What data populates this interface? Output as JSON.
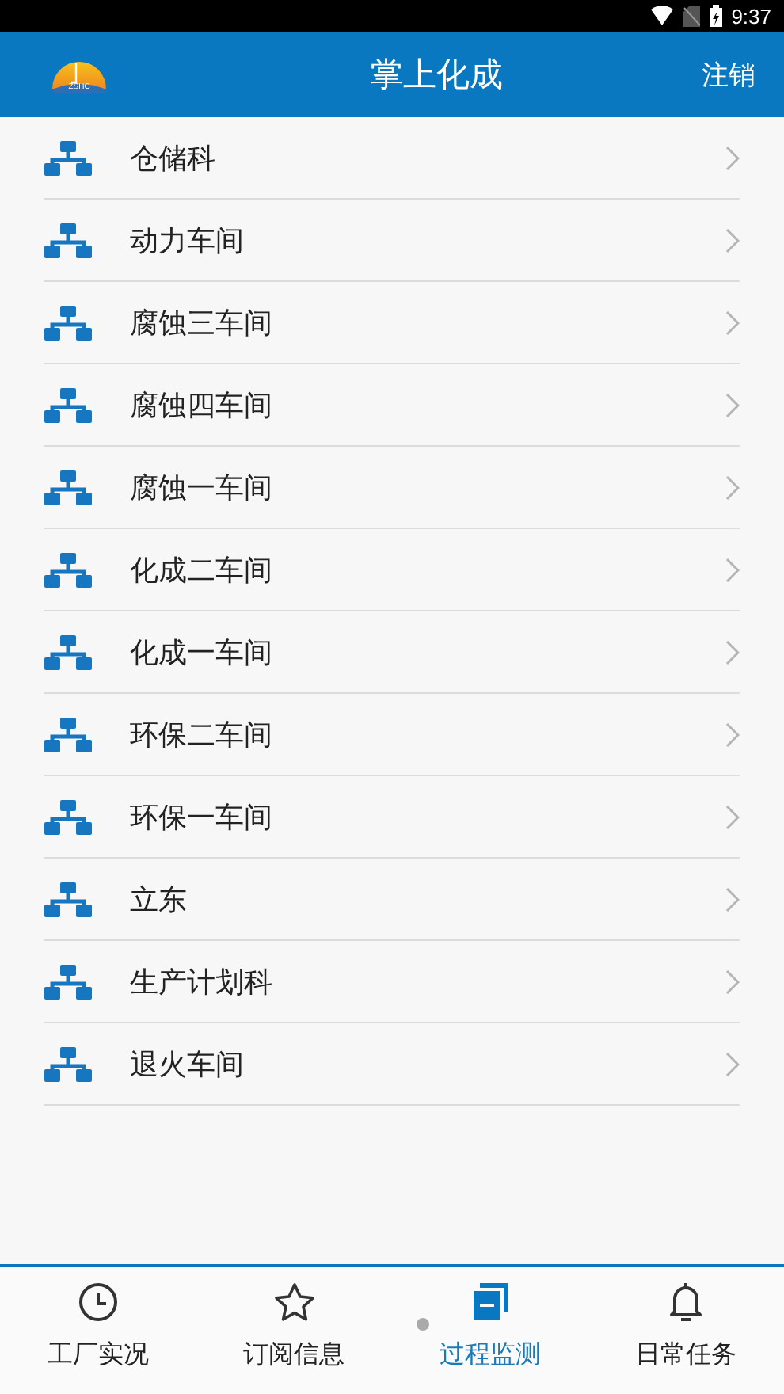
{
  "status_bar": {
    "time": "9:37"
  },
  "header": {
    "logo_text": "ZSHC",
    "title": "掌上化成",
    "action": "注销"
  },
  "departments": [
    {
      "name": "仓储科"
    },
    {
      "name": "动力车间"
    },
    {
      "name": "腐蚀三车间"
    },
    {
      "name": "腐蚀四车间"
    },
    {
      "name": "腐蚀一车间"
    },
    {
      "name": "化成二车间"
    },
    {
      "name": "化成一车间"
    },
    {
      "name": "环保二车间"
    },
    {
      "name": "环保一车间"
    },
    {
      "name": "立东"
    },
    {
      "name": "生产计划科"
    },
    {
      "name": "退火车间"
    }
  ],
  "bottom_nav": [
    {
      "label": "工厂实况",
      "kind": "clock",
      "selected": false
    },
    {
      "label": "订阅信息",
      "kind": "star",
      "selected": false
    },
    {
      "label": "过程监测",
      "kind": "windows",
      "selected": true
    },
    {
      "label": "日常任务",
      "kind": "bell",
      "selected": false
    }
  ]
}
